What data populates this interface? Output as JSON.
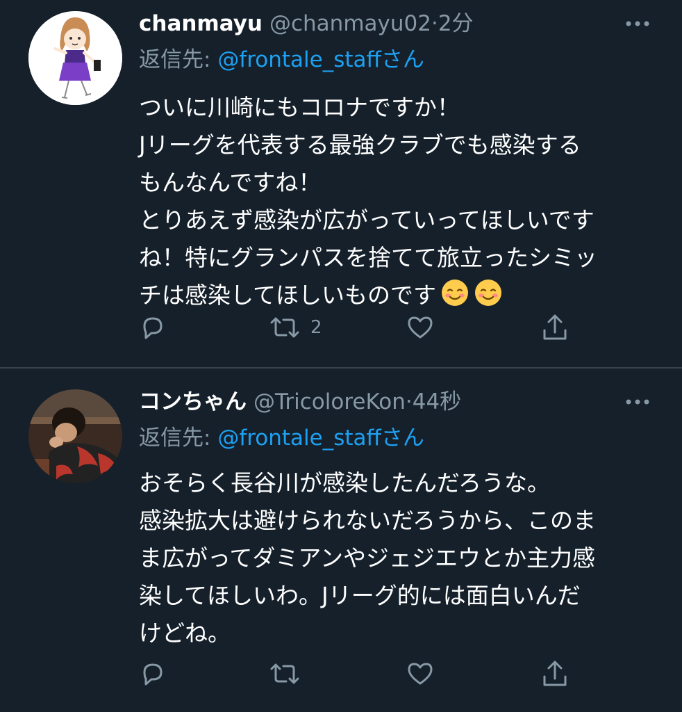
{
  "tweets": [
    {
      "display_name": "chanmayu",
      "handle": "@chanmayu02",
      "separator": "·",
      "time": "2分",
      "reply_prefix": "返信先: ",
      "reply_user": "@frontale_staff",
      "reply_suffix": "さん",
      "body_lines": [
        "ついに川崎にもコロナですか！",
        "Jリーグを代表する最強クラブでも感染する",
        "もんなんですね！",
        "とりあえず感染が広がっていってほしいです",
        "ね！特にグランパスを捨てて旅立ったシミッ",
        "チは感染してほしいものです"
      ],
      "emojis": [
        "smiling-face-emoji",
        "smiling-face-emoji"
      ],
      "retweet_count": "2",
      "avatar_icon": "illustrated-girl-avatar"
    },
    {
      "display_name": "コンちゃん",
      "handle": "@TricoloreKon",
      "separator": "·",
      "time": "44秒",
      "reply_prefix": "返信先: ",
      "reply_user": "@frontale_staff",
      "reply_suffix": "さん",
      "body_lines": [
        "おそらく長谷川が感染したんだろうな。",
        "感染拡大は避けられないだろうから、このま",
        "ま広がってダミアンやジェジエウとか主力感",
        "染してほしいわ。Jリーグ的には面白いんだ",
        "けどね。"
      ],
      "retweet_count": "",
      "avatar_icon": "photo-person-avatar"
    }
  ],
  "colors": {
    "background": "#15202b",
    "text": "#ffffff",
    "secondary": "#8899a6",
    "link": "#1da1f2",
    "divider": "#38444d"
  },
  "icons": {
    "reply": "reply-icon",
    "retweet": "retweet-icon",
    "like": "heart-icon",
    "share": "share-icon",
    "more": "more-icon"
  }
}
